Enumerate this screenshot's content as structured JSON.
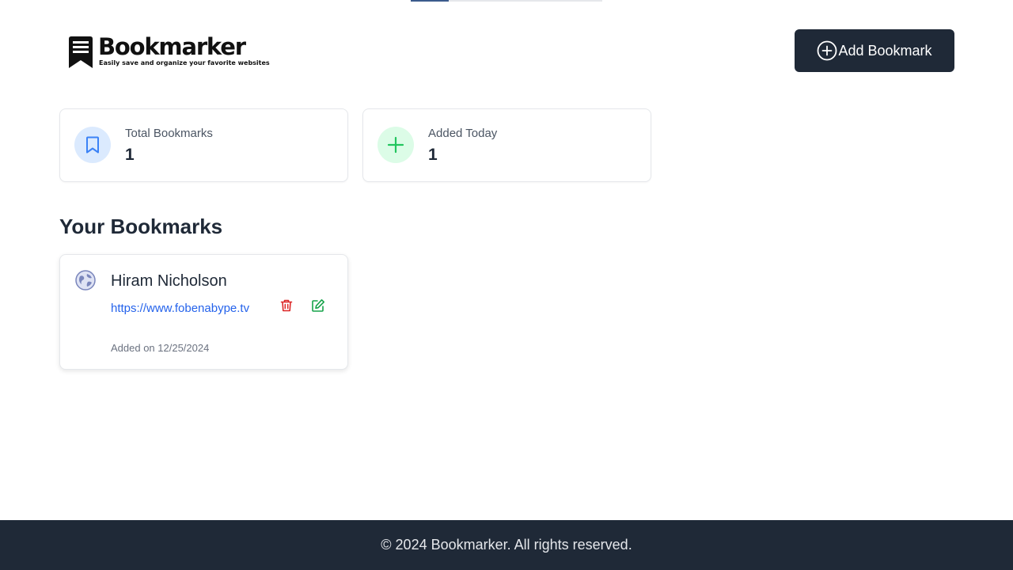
{
  "progress": {
    "fraction": 0.2
  },
  "header": {
    "logo": {
      "icon": "bookmark-logo-icon",
      "title": "Bookmarker",
      "tagline": "Easily save and organize your favorite websites"
    },
    "add_button": {
      "icon": "plus-circle-icon",
      "label": "Add Bookmark"
    }
  },
  "stats": [
    {
      "icon": "bookmark-icon",
      "label": "Total Bookmarks",
      "value": "1",
      "color": "#3b82f6"
    },
    {
      "icon": "plus-icon",
      "label": "Added Today",
      "value": "1",
      "color": "#22c55e"
    }
  ],
  "bookmarks_section": {
    "title": "Your Bookmarks",
    "items": [
      {
        "favicon": "globe-icon",
        "title": "Hiram Nicholson",
        "url": "https://www.fobenabype.tv",
        "added": "Added on 12/25/2024",
        "delete_icon": "trash-icon",
        "edit_icon": "edit-icon"
      }
    ]
  },
  "footer": {
    "text": "© 2024 Bookmarker. All rights reserved."
  },
  "colors": {
    "primary_dark": "#1f2937",
    "link": "#2563eb",
    "delete": "#dc2626",
    "edit": "#16a34a"
  }
}
